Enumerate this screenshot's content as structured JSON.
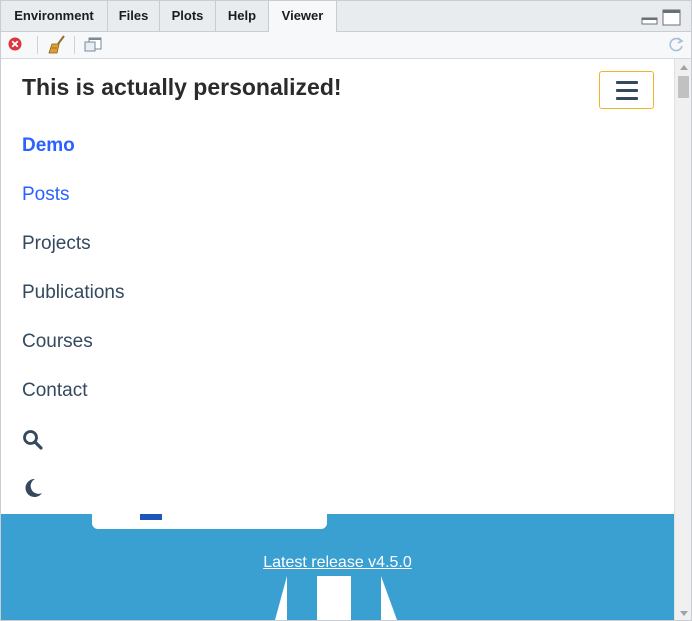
{
  "tabs": [
    {
      "label": "Environment",
      "active": false
    },
    {
      "label": "Files",
      "active": false
    },
    {
      "label": "Plots",
      "active": false
    },
    {
      "label": "Help",
      "active": false
    },
    {
      "label": "Viewer",
      "active": true
    }
  ],
  "toolbar": {
    "icons": [
      "stop-icon",
      "broom-icon",
      "popout-viewer-icon",
      "refresh-icon"
    ]
  },
  "site": {
    "brand": "This is actually personalized!",
    "nav": [
      {
        "label": "Demo",
        "state": "active"
      },
      {
        "label": "Posts",
        "state": "link"
      },
      {
        "label": "Projects",
        "state": "normal"
      },
      {
        "label": "Publications",
        "state": "normal"
      },
      {
        "label": "Courses",
        "state": "normal"
      },
      {
        "label": "Contact",
        "state": "normal"
      }
    ],
    "icons": [
      "search-icon",
      "moon-icon",
      "hamburger-menu-icon"
    ],
    "release_link": "Latest release v4.5.0"
  },
  "colors": {
    "accent": "#2962ff",
    "nav_text": "#34495e",
    "hero_bg": "#3aa0d1",
    "toggle_border": "#f0b429"
  }
}
